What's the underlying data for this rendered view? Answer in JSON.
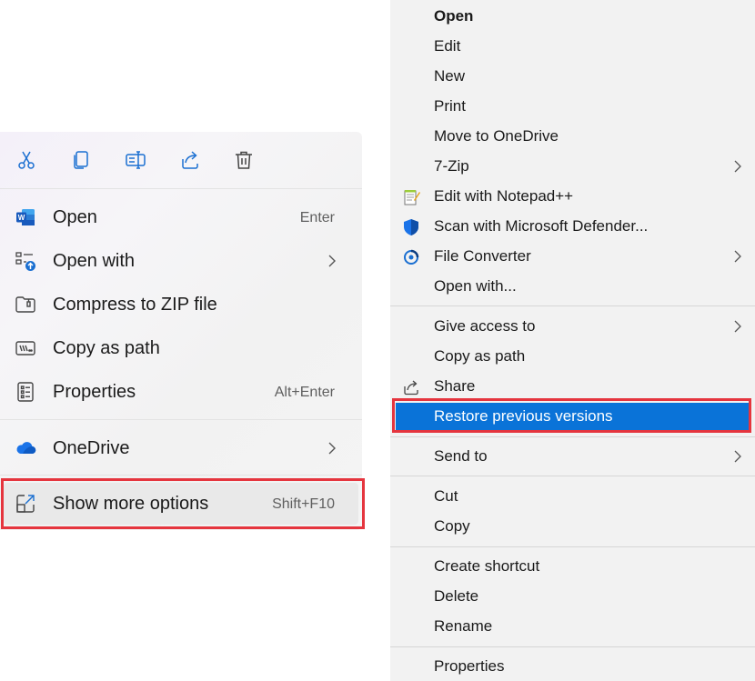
{
  "modern_menu": {
    "toolbar": [
      {
        "name": "cut",
        "icon": "scissors-icon"
      },
      {
        "name": "copy",
        "icon": "copy-icon"
      },
      {
        "name": "rename",
        "icon": "rename-icon"
      },
      {
        "name": "share",
        "icon": "share-icon"
      },
      {
        "name": "delete",
        "icon": "trash-icon"
      }
    ],
    "items": {
      "open": {
        "label": "Open",
        "shortcut": "Enter",
        "icon": "word-icon"
      },
      "open_with": {
        "label": "Open with",
        "icon": "open-with-icon"
      },
      "compress": {
        "label": "Compress to ZIP file",
        "icon": "zip-folder-icon"
      },
      "copy_path": {
        "label": "Copy as path",
        "icon": "path-icon"
      },
      "properties": {
        "label": "Properties",
        "shortcut": "Alt+Enter",
        "icon": "properties-icon"
      },
      "onedrive": {
        "label": "OneDrive",
        "icon": "cloud-icon"
      },
      "show_more": {
        "label": "Show more options",
        "shortcut": "Shift+F10",
        "icon": "expand-icon"
      }
    }
  },
  "classic_menu": {
    "items": {
      "open": {
        "label": "Open"
      },
      "edit": {
        "label": "Edit"
      },
      "new": {
        "label": "New"
      },
      "print": {
        "label": "Print"
      },
      "move_onedrive": {
        "label": "Move to OneDrive"
      },
      "zip7": {
        "label": "7-Zip"
      },
      "notepadpp": {
        "label": "Edit with Notepad++",
        "icon": "notepad-icon"
      },
      "defender": {
        "label": "Scan with Microsoft Defender...",
        "icon": "shield-icon"
      },
      "file_converter": {
        "label": "File Converter",
        "icon": "converter-icon"
      },
      "open_with": {
        "label": "Open with..."
      },
      "give_access": {
        "label": "Give access to"
      },
      "copy_path": {
        "label": "Copy as path"
      },
      "share": {
        "label": "Share",
        "icon": "share-icon"
      },
      "restore": {
        "label": "Restore previous versions"
      },
      "send_to": {
        "label": "Send to"
      },
      "cut": {
        "label": "Cut"
      },
      "copy": {
        "label": "Copy"
      },
      "create_shortcut": {
        "label": "Create shortcut"
      },
      "delete": {
        "label": "Delete"
      },
      "rename": {
        "label": "Rename"
      },
      "properties": {
        "label": "Properties"
      }
    }
  },
  "colors": {
    "highlight_blue": "#0a73d8",
    "annotation_red": "#e5353e",
    "accent_blue": "#1a6fd1"
  }
}
